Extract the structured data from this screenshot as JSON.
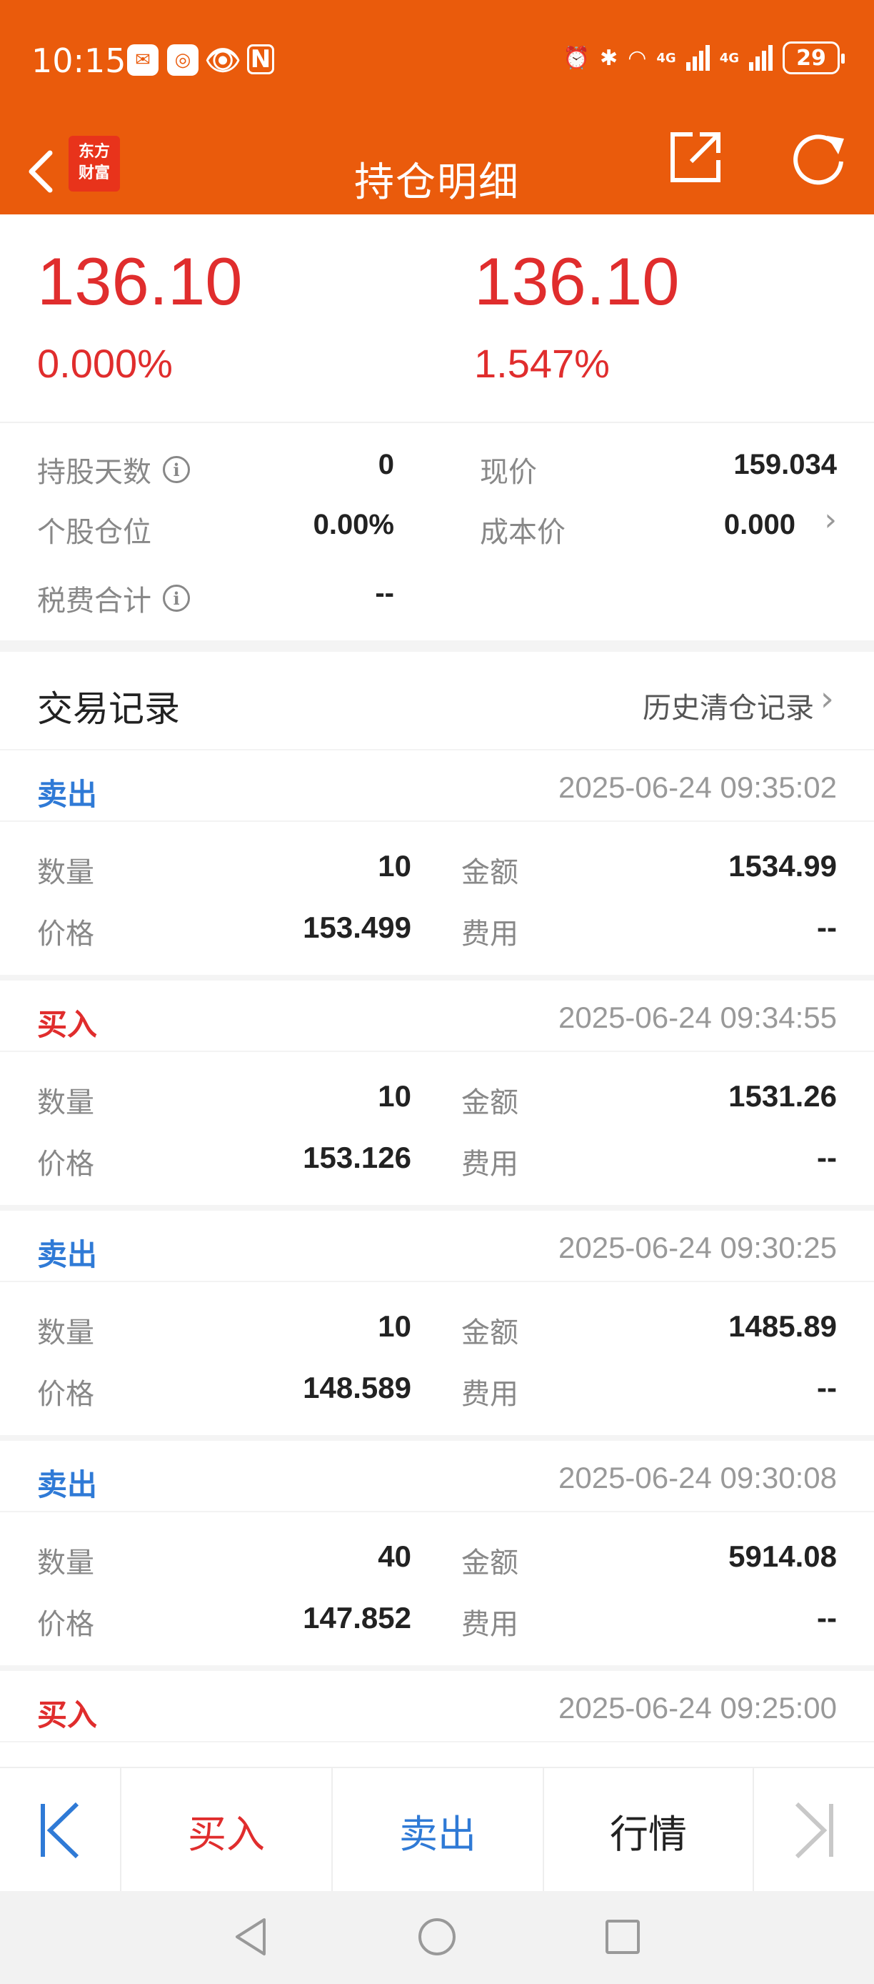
{
  "status_bar": {
    "time": "10:15",
    "battery": "29",
    "net1": "4G",
    "net2": "4G",
    "wifi_label": "6"
  },
  "nav": {
    "title": "持仓明细",
    "logo_line1": "东方",
    "logo_line2": "财富"
  },
  "summary": {
    "left_value": "136.10",
    "left_pct": "0.000%",
    "right_value": "136.10",
    "right_pct": "1.547%"
  },
  "details": {
    "hold_days_label": "持股天数",
    "hold_days_value": "0",
    "position_label": "个股仓位",
    "position_value": "0.00%",
    "tax_label": "税费合计",
    "tax_value": "--",
    "price_label": "现价",
    "price_value": "159.034",
    "cost_label": "成本价",
    "cost_value": "0.000"
  },
  "records": {
    "title": "交易记录",
    "history_link": "历史清仓记录",
    "labels": {
      "qty": "数量",
      "price": "价格",
      "amount": "金额",
      "fee": "费用"
    },
    "items": [
      {
        "type": "卖出",
        "time": "2025-06-24 09:35:02",
        "qty": "10",
        "price": "153.499",
        "amount": "1534.99",
        "fee": "--"
      },
      {
        "type": "买入",
        "time": "2025-06-24 09:34:55",
        "qty": "10",
        "price": "153.126",
        "amount": "1531.26",
        "fee": "--"
      },
      {
        "type": "卖出",
        "time": "2025-06-24 09:30:25",
        "qty": "10",
        "price": "148.589",
        "amount": "1485.89",
        "fee": "--"
      },
      {
        "type": "卖出",
        "time": "2025-06-24 09:30:08",
        "qty": "40",
        "price": "147.852",
        "amount": "5914.08",
        "fee": "--"
      },
      {
        "type": "买入",
        "time": "2025-06-24 09:25:00",
        "qty": "",
        "price": "",
        "amount": "",
        "fee": ""
      }
    ]
  },
  "actions": {
    "buy": "买入",
    "sell": "卖出",
    "quote": "行情"
  },
  "colors": {
    "header": "#ea5b0c",
    "up_red": "#e02d2d",
    "sell_blue": "#2f7ad6"
  }
}
